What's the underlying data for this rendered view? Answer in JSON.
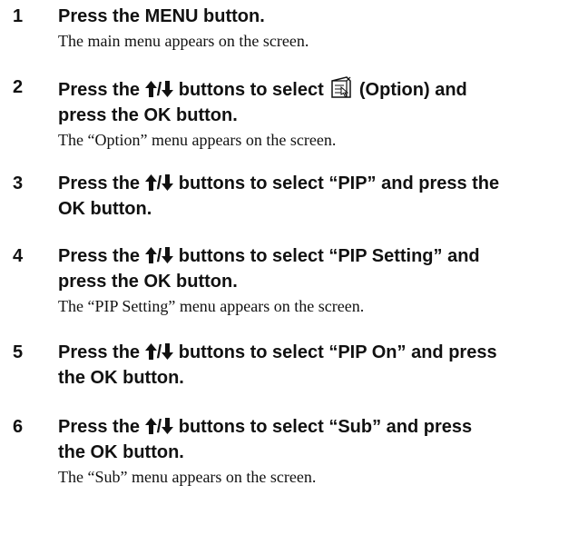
{
  "steps": [
    {
      "number": "1",
      "line1": "Press the MENU button.",
      "description": "The main menu appears on the screen."
    },
    {
      "number": "2",
      "line1_prefix": "Press the",
      "arrow_separator": "/",
      "line1_mid": "buttons to select",
      "icon": "option-icon",
      "line1_suffix": "(Option) and",
      "line2": "press the OK button.",
      "description": "The “Option” menu appears on the screen."
    },
    {
      "number": "3",
      "line1_prefix": "Press the",
      "arrow_separator": "/",
      "line1_suffix": "buttons to select “PIP” and press the",
      "line2": "OK button."
    },
    {
      "number": "4",
      "line1_prefix": "Press the",
      "arrow_separator": "/",
      "line1_suffix": "buttons to select “PIP Setting” and",
      "line2": "press the OK button.",
      "description": "The “PIP Setting” menu appears on the screen."
    },
    {
      "number": "5",
      "line1_prefix": "Press the",
      "arrow_separator": "/",
      "line1_suffix": "buttons to select “PIP On” and press",
      "line2": "the OK button."
    },
    {
      "number": "6",
      "line1_prefix": "Press the",
      "arrow_separator": "/",
      "line1_suffix": "buttons to select “Sub” and press",
      "line2": "the OK button.",
      "description": "The “Sub” menu appears on the screen."
    }
  ]
}
